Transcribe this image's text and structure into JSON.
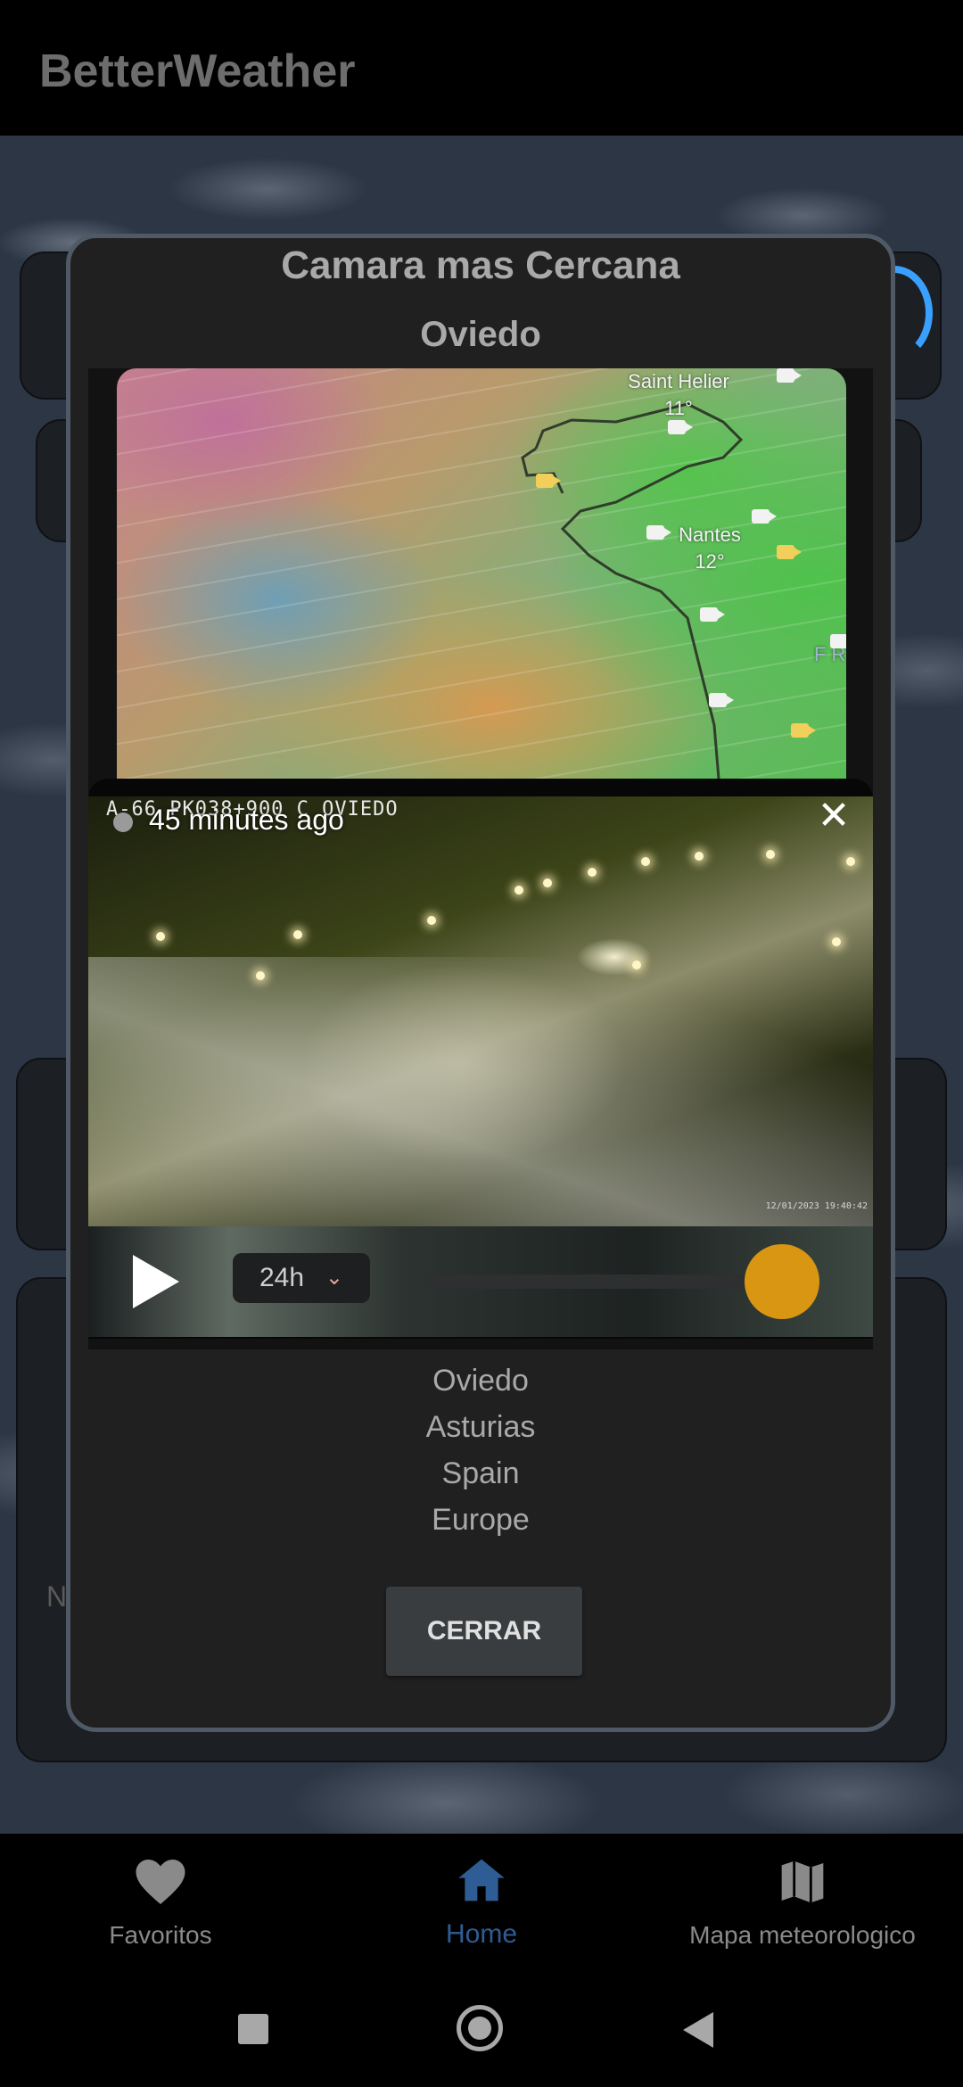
{
  "app": {
    "title": "BetterWeather"
  },
  "background": {
    "partial_text": "N"
  },
  "dialog": {
    "title": "Camara mas Cercana",
    "subtitle": "Oviedo",
    "map": {
      "labels": [
        {
          "name": "Saint Helier",
          "temp": "11°"
        },
        {
          "name": "Nantes",
          "temp": "12°"
        }
      ],
      "edge_text": "F R"
    },
    "camera": {
      "stamp": "A-66 PK038+900 C OVIEDO",
      "age": "45 minutes ago",
      "close_icon": "close-icon",
      "timestamp": "12/01/2023 19:40:42",
      "range_label": "24h",
      "slider_position": 1.0,
      "accent": "#d99612"
    },
    "location": [
      "Oviedo",
      "Asturias",
      "Spain",
      "Europe"
    ],
    "close_button": "CERRAR"
  },
  "bottom_nav": {
    "items": [
      {
        "label": "Favoritos",
        "icon": "heart-icon"
      },
      {
        "label": "Home",
        "icon": "home-icon",
        "active": true
      },
      {
        "label": "Mapa meteorologico",
        "icon": "map-icon"
      }
    ],
    "active_color": "#2d5d94"
  },
  "system_nav": {
    "icons": [
      "recents-square-icon",
      "home-circle-icon",
      "back-triangle-icon"
    ]
  }
}
